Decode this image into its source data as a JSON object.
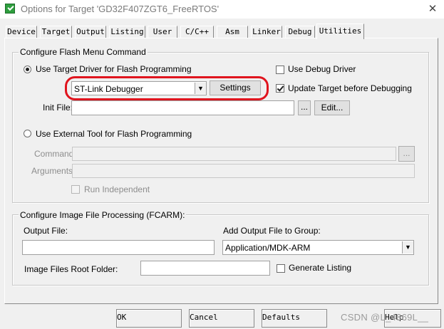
{
  "window": {
    "title": "Options for Target 'GD32F407ZGT6_FreeRTOS'",
    "close_glyph": "✕"
  },
  "tabs": [
    {
      "label": "Device",
      "active": false
    },
    {
      "label": "Target",
      "active": false
    },
    {
      "label": "Output",
      "active": false
    },
    {
      "label": "Listing",
      "active": false
    },
    {
      "label": "User",
      "active": false
    },
    {
      "label": "C/C++",
      "active": false
    },
    {
      "label": "Asm",
      "active": false
    },
    {
      "label": "Linker",
      "active": false
    },
    {
      "label": "Debug",
      "active": false
    },
    {
      "label": "Utilities",
      "active": true
    }
  ],
  "flash_group": {
    "legend": "Configure Flash Menu Command",
    "use_target_driver": {
      "label": "Use Target Driver for Flash Programming",
      "selected": true
    },
    "driver_combo": {
      "value": "ST-Link Debugger"
    },
    "settings_button": "Settings",
    "use_debug_driver": {
      "label": "Use Debug Driver",
      "checked": false
    },
    "update_target": {
      "label": "Update Target before Debugging",
      "checked": true
    },
    "init_file": {
      "label": "Init File:",
      "value": "",
      "browse": "...",
      "edit": "Edit..."
    },
    "use_external_tool": {
      "label": "Use External Tool for Flash Programming",
      "selected": false
    },
    "command": {
      "label": "Command:",
      "value": "",
      "browse": "..."
    },
    "arguments": {
      "label": "Arguments:",
      "value": ""
    },
    "run_independent": {
      "label": "Run Independent",
      "checked": false
    }
  },
  "image_group": {
    "legend": "Configure Image File Processing (FCARM):",
    "output_file": {
      "label": "Output File:",
      "value": ""
    },
    "add_output_group": {
      "label": "Add Output File  to Group:",
      "value": "Application/MDK-ARM"
    },
    "root_folder": {
      "label": "Image Files Root Folder:",
      "value": ""
    },
    "generate_listing": {
      "label": "Generate Listing",
      "checked": false
    }
  },
  "buttons": {
    "ok": "OK",
    "cancel": "Cancel",
    "defaults": "Defaults",
    "help": "Help"
  },
  "watermark": "CSDN @L_4869L__",
  "colors": {
    "highlight": "#e0141e",
    "dialog_bg": "#f0f0f0",
    "app_icon": "#2e9e3e"
  }
}
